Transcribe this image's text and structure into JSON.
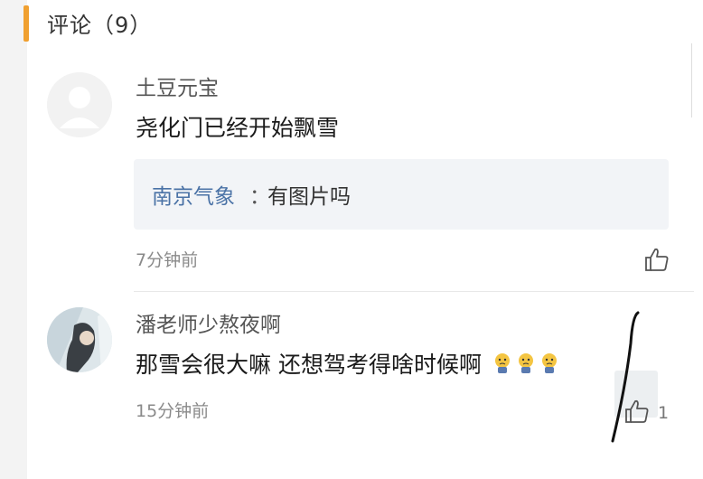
{
  "header": {
    "title": "评论（9）"
  },
  "comments": [
    {
      "user": "土豆元宝",
      "text": "尧化门已经开始飘雪",
      "reply": {
        "user": "南京气象",
        "separator": "：",
        "text": "有图片吗"
      },
      "time": "7分钟前",
      "likes": ""
    },
    {
      "user": "潘老师少熬夜啊",
      "text": "那雪会很大嘛 还想驾考得啥时候啊",
      "emoji_count": 3,
      "time": "15分钟前",
      "likes": "1"
    }
  ],
  "icons": [
    "thumbs-up-icon",
    "crying-emoji-icon"
  ],
  "colors": {
    "accent": "#f0a030",
    "reply_name": "#4a72a6",
    "bg": "#f3f3f3"
  }
}
